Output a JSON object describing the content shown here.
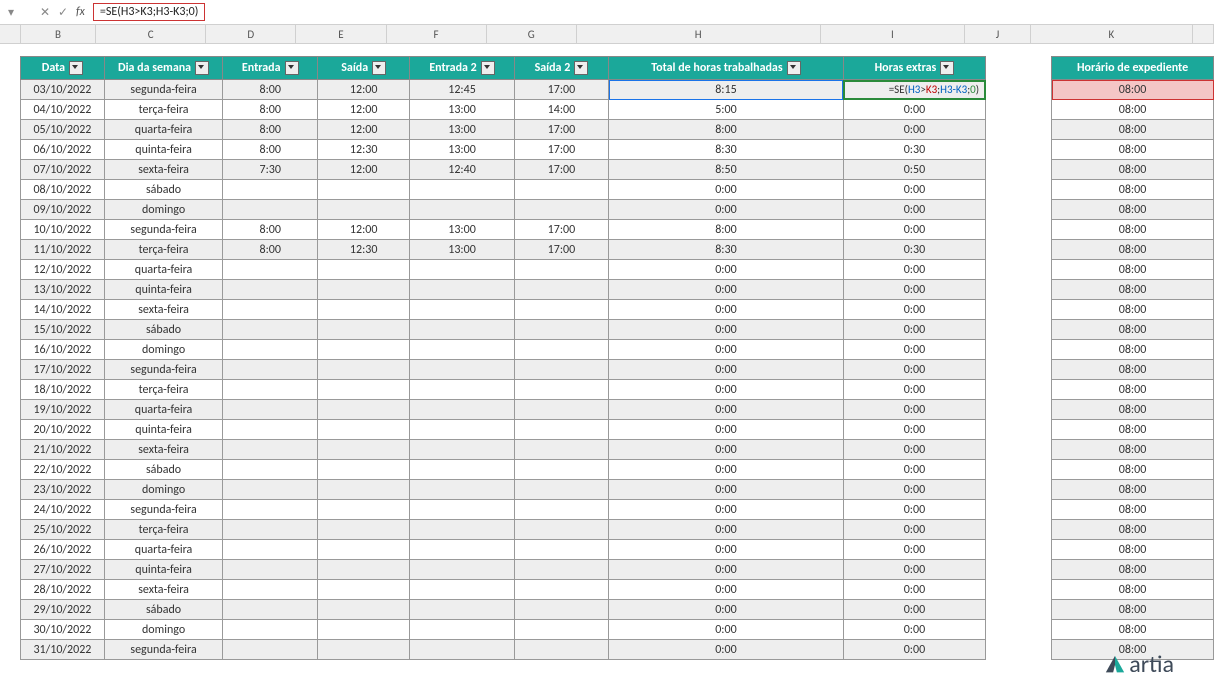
{
  "formula_bar": {
    "display": "=SE(H3>K3;H3-K3;0)"
  },
  "columns": [
    "B",
    "C",
    "D",
    "E",
    "F",
    "G",
    "H",
    "I",
    "J",
    "K"
  ],
  "headers": {
    "data": "Data",
    "dia": "Dia da semana",
    "entrada": "Entrada",
    "saida": "Saída",
    "entrada2": "Entrada 2",
    "saida2": "Saída 2",
    "total": "Total de horas trabalhadas",
    "extras": "Horas extras",
    "expediente": "Horário de expediente"
  },
  "cell_I3_formula_parts": {
    "p1": "=SE(",
    "p2": "H3",
    "p3": ">",
    "p4": "K3",
    "p5": ";",
    "p6": "H3-K3",
    "p7": ";",
    "p8": "0",
    "p9": ")"
  },
  "rows": [
    {
      "data": "03/10/2022",
      "dia": "segunda-feira",
      "e": "8:00",
      "s": "12:00",
      "e2": "12:45",
      "s2": "17:00",
      "tot": "8:15",
      "ext": "",
      "exp": "08:00"
    },
    {
      "data": "04/10/2022",
      "dia": "terça-feira",
      "e": "8:00",
      "s": "12:00",
      "e2": "13:00",
      "s2": "14:00",
      "tot": "5:00",
      "ext": "0:00",
      "exp": "08:00"
    },
    {
      "data": "05/10/2022",
      "dia": "quarta-feira",
      "e": "8:00",
      "s": "12:00",
      "e2": "13:00",
      "s2": "17:00",
      "tot": "8:00",
      "ext": "0:00",
      "exp": "08:00"
    },
    {
      "data": "06/10/2022",
      "dia": "quinta-feira",
      "e": "8:00",
      "s": "12:30",
      "e2": "13:00",
      "s2": "17:00",
      "tot": "8:30",
      "ext": "0:30",
      "exp": "08:00"
    },
    {
      "data": "07/10/2022",
      "dia": "sexta-feira",
      "e": "7:30",
      "s": "12:00",
      "e2": "12:40",
      "s2": "17:00",
      "tot": "8:50",
      "ext": "0:50",
      "exp": "08:00"
    },
    {
      "data": "08/10/2022",
      "dia": "sábado",
      "e": "",
      "s": "",
      "e2": "",
      "s2": "",
      "tot": "0:00",
      "ext": "0:00",
      "exp": "08:00"
    },
    {
      "data": "09/10/2022",
      "dia": "domingo",
      "e": "",
      "s": "",
      "e2": "",
      "s2": "",
      "tot": "0:00",
      "ext": "0:00",
      "exp": "08:00"
    },
    {
      "data": "10/10/2022",
      "dia": "segunda-feira",
      "e": "8:00",
      "s": "12:00",
      "e2": "13:00",
      "s2": "17:00",
      "tot": "8:00",
      "ext": "0:00",
      "exp": "08:00"
    },
    {
      "data": "11/10/2022",
      "dia": "terça-feira",
      "e": "8:00",
      "s": "12:30",
      "e2": "13:00",
      "s2": "17:00",
      "tot": "8:30",
      "ext": "0:30",
      "exp": "08:00"
    },
    {
      "data": "12/10/2022",
      "dia": "quarta-feira",
      "e": "",
      "s": "",
      "e2": "",
      "s2": "",
      "tot": "0:00",
      "ext": "0:00",
      "exp": "08:00"
    },
    {
      "data": "13/10/2022",
      "dia": "quinta-feira",
      "e": "",
      "s": "",
      "e2": "",
      "s2": "",
      "tot": "0:00",
      "ext": "0:00",
      "exp": "08:00"
    },
    {
      "data": "14/10/2022",
      "dia": "sexta-feira",
      "e": "",
      "s": "",
      "e2": "",
      "s2": "",
      "tot": "0:00",
      "ext": "0:00",
      "exp": "08:00"
    },
    {
      "data": "15/10/2022",
      "dia": "sábado",
      "e": "",
      "s": "",
      "e2": "",
      "s2": "",
      "tot": "0:00",
      "ext": "0:00",
      "exp": "08:00"
    },
    {
      "data": "16/10/2022",
      "dia": "domingo",
      "e": "",
      "s": "",
      "e2": "",
      "s2": "",
      "tot": "0:00",
      "ext": "0:00",
      "exp": "08:00"
    },
    {
      "data": "17/10/2022",
      "dia": "segunda-feira",
      "e": "",
      "s": "",
      "e2": "",
      "s2": "",
      "tot": "0:00",
      "ext": "0:00",
      "exp": "08:00"
    },
    {
      "data": "18/10/2022",
      "dia": "terça-feira",
      "e": "",
      "s": "",
      "e2": "",
      "s2": "",
      "tot": "0:00",
      "ext": "0:00",
      "exp": "08:00"
    },
    {
      "data": "19/10/2022",
      "dia": "quarta-feira",
      "e": "",
      "s": "",
      "e2": "",
      "s2": "",
      "tot": "0:00",
      "ext": "0:00",
      "exp": "08:00"
    },
    {
      "data": "20/10/2022",
      "dia": "quinta-feira",
      "e": "",
      "s": "",
      "e2": "",
      "s2": "",
      "tot": "0:00",
      "ext": "0:00",
      "exp": "08:00"
    },
    {
      "data": "21/10/2022",
      "dia": "sexta-feira",
      "e": "",
      "s": "",
      "e2": "",
      "s2": "",
      "tot": "0:00",
      "ext": "0:00",
      "exp": "08:00"
    },
    {
      "data": "22/10/2022",
      "dia": "sábado",
      "e": "",
      "s": "",
      "e2": "",
      "s2": "",
      "tot": "0:00",
      "ext": "0:00",
      "exp": "08:00"
    },
    {
      "data": "23/10/2022",
      "dia": "domingo",
      "e": "",
      "s": "",
      "e2": "",
      "s2": "",
      "tot": "0:00",
      "ext": "0:00",
      "exp": "08:00"
    },
    {
      "data": "24/10/2022",
      "dia": "segunda-feira",
      "e": "",
      "s": "",
      "e2": "",
      "s2": "",
      "tot": "0:00",
      "ext": "0:00",
      "exp": "08:00"
    },
    {
      "data": "25/10/2022",
      "dia": "terça-feira",
      "e": "",
      "s": "",
      "e2": "",
      "s2": "",
      "tot": "0:00",
      "ext": "0:00",
      "exp": "08:00"
    },
    {
      "data": "26/10/2022",
      "dia": "quarta-feira",
      "e": "",
      "s": "",
      "e2": "",
      "s2": "",
      "tot": "0:00",
      "ext": "0:00",
      "exp": "08:00"
    },
    {
      "data": "27/10/2022",
      "dia": "quinta-feira",
      "e": "",
      "s": "",
      "e2": "",
      "s2": "",
      "tot": "0:00",
      "ext": "0:00",
      "exp": "08:00"
    },
    {
      "data": "28/10/2022",
      "dia": "sexta-feira",
      "e": "",
      "s": "",
      "e2": "",
      "s2": "",
      "tot": "0:00",
      "ext": "0:00",
      "exp": "08:00"
    },
    {
      "data": "29/10/2022",
      "dia": "sábado",
      "e": "",
      "s": "",
      "e2": "",
      "s2": "",
      "tot": "0:00",
      "ext": "0:00",
      "exp": "08:00"
    },
    {
      "data": "30/10/2022",
      "dia": "domingo",
      "e": "",
      "s": "",
      "e2": "",
      "s2": "",
      "tot": "0:00",
      "ext": "0:00",
      "exp": "08:00"
    },
    {
      "data": "31/10/2022",
      "dia": "segunda-feira",
      "e": "",
      "s": "",
      "e2": "",
      "s2": "",
      "tot": "0:00",
      "ext": "0:00",
      "exp": "08:00"
    }
  ],
  "brand": "artia"
}
